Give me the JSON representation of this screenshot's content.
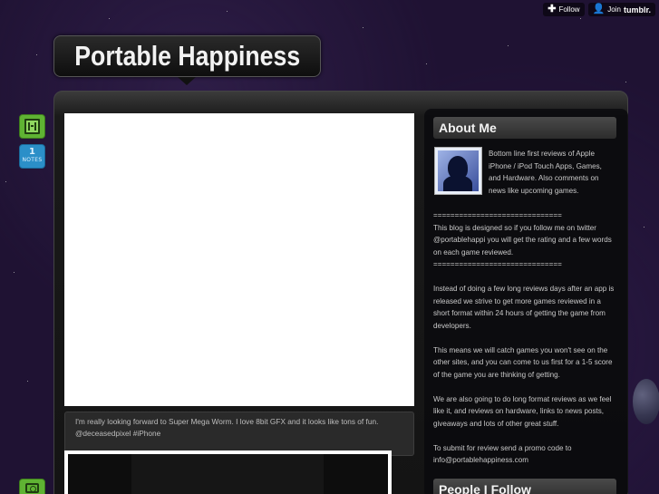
{
  "tumblr_controls": {
    "follow_label": "Follow",
    "join_label": "Join",
    "brand": "tumblr.",
    "follow_icon": "plus-icon",
    "join_icon": "person-icon"
  },
  "blog": {
    "title": "Portable Happiness"
  },
  "post": {
    "type_icon": "film-icon",
    "notes_count": "1",
    "notes_label": "NOTES",
    "caption_line1": "I'm really looking forward to Super Mega Worm. I love 8bit GFX and it looks like tons of fun.",
    "caption_line2": "@deceasedpixel #iPhone"
  },
  "sidebar": {
    "about_title": "About Me",
    "about_intro": "Bottom line first reviews of Apple iPhone / iPod Touch Apps, Games, and Hardware. Also comments on news like upcoming games.",
    "divider_top": "==============================",
    "twitter_note": "This blog is designed so if you follow me on twitter @portablehappi you will get the rating and a few words on each game reviewed.",
    "divider_bottom": "==============================",
    "para_2": "Instead of doing a few long reviews days after an app is released we strive to get more games reviewed in a short format within 24 hours of getting the game from developers.",
    "para_3": "This means we will catch games you won't see on the other sites, and you can come to us first for a 1-5 score of the game you are thinking of getting.",
    "para_4": "We are also going to do long format reviews as we feel like it, and reviews on hardware, links to news posts, giveaways and lots of other great stuff.",
    "para_5": "To submit for review send a promo code to info@portablehappiness.com",
    "people_title": "People I Follow"
  },
  "colors": {
    "background": "#1f1233",
    "video_badge": "#5fb333",
    "notes_badge": "#2b8fc8"
  }
}
